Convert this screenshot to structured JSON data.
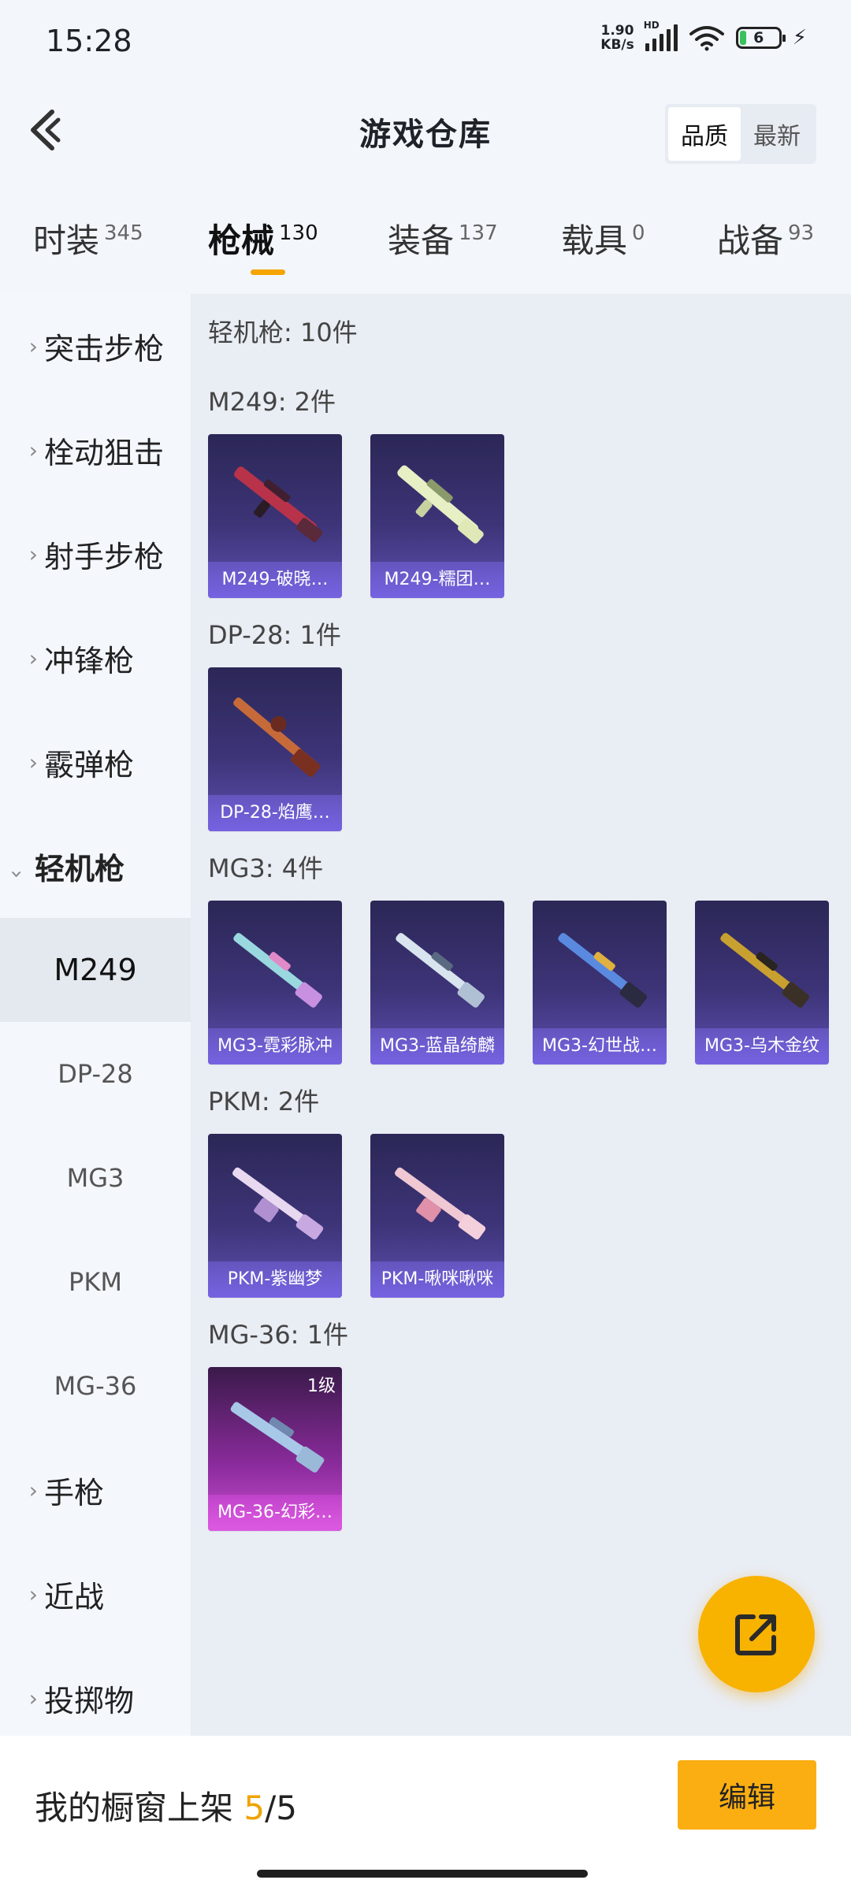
{
  "status_bar": {
    "time": "15:28",
    "net_speed_value": "1.90",
    "net_speed_unit": "KB/s",
    "signal_badge": "HD",
    "battery": "6"
  },
  "header": {
    "title": "游戏仓库",
    "sort_options": [
      "品质",
      "最新"
    ]
  },
  "tabs": [
    {
      "label": "时装",
      "count": "345"
    },
    {
      "label": "枪械",
      "count": "130"
    },
    {
      "label": "装备",
      "count": "137"
    },
    {
      "label": "载具",
      "count": "0"
    },
    {
      "label": "战备",
      "count": "93"
    }
  ],
  "sidebar": {
    "categories_top": [
      "突击步枪",
      "栓动狙击",
      "射手步枪",
      "冲锋枪",
      "霰弹枪"
    ],
    "open_category": "轻机枪",
    "sub_items": [
      "M249",
      "DP-28",
      "MG3",
      "PKM",
      "MG-36"
    ],
    "categories_bottom": [
      "手枪",
      "近战",
      "投掷物"
    ]
  },
  "content": {
    "total": "轻机枪: 10件",
    "groups": [
      {
        "heading": "M249: 2件",
        "items": [
          {
            "name": "M249-破晓…",
            "level": ""
          },
          {
            "name": "M249-糯团…",
            "level": ""
          }
        ]
      },
      {
        "heading": "DP-28: 1件",
        "items": [
          {
            "name": "DP-28-焰鹰…",
            "level": ""
          }
        ]
      },
      {
        "heading": "MG3: 4件",
        "items": [
          {
            "name": "MG3-霓彩脉冲",
            "level": ""
          },
          {
            "name": "MG3-蓝晶绮麟",
            "level": ""
          },
          {
            "name": "MG3-幻世战…",
            "level": ""
          },
          {
            "name": "MG3-乌木金纹",
            "level": ""
          }
        ]
      },
      {
        "heading": "PKM: 2件",
        "items": [
          {
            "name": "PKM-紫幽梦",
            "level": ""
          },
          {
            "name": "PKM-啾咪啾咪",
            "level": ""
          }
        ]
      },
      {
        "heading": "MG-36: 1件",
        "items": [
          {
            "name": "MG-36-幻彩…",
            "level": "1级"
          }
        ]
      }
    ]
  },
  "bottom_bar": {
    "showcase_label": "我的橱窗上架",
    "showcase_used": "5",
    "showcase_total": "/5",
    "edit_label": "编辑"
  },
  "colors": {
    "accent": "#f8b200",
    "card_purple": "#3d3478",
    "card_pink": "#c94fd0"
  }
}
